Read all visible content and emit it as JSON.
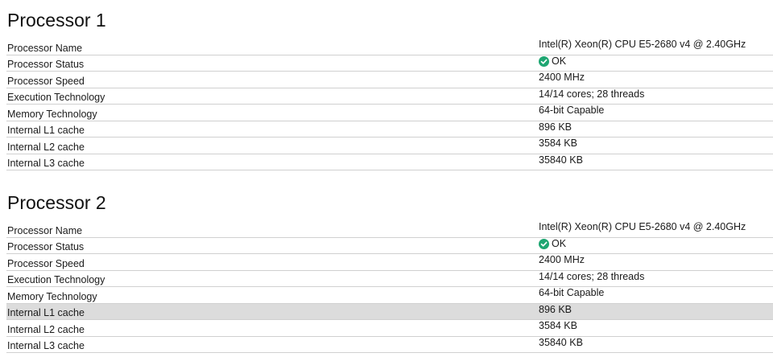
{
  "processors": [
    {
      "title": "Processor 1",
      "rows": [
        {
          "label": "Processor Name",
          "value": "Intel(R) Xeon(R) CPU E5-2680 v4 @ 2.40GHz"
        },
        {
          "label": "Processor Status",
          "value": "OK",
          "status_icon": "check-circle-icon",
          "status_color": "#1ea672"
        },
        {
          "label": "Processor Speed",
          "value": "2400 MHz"
        },
        {
          "label": "Execution Technology",
          "value": "14/14 cores; 28 threads"
        },
        {
          "label": "Memory Technology",
          "value": "64-bit Capable"
        },
        {
          "label": "Internal L1 cache",
          "value": "896 KB"
        },
        {
          "label": "Internal L2 cache",
          "value": "3584 KB"
        },
        {
          "label": "Internal L3 cache",
          "value": "35840 KB"
        }
      ]
    },
    {
      "title": "Processor 2",
      "rows": [
        {
          "label": "Processor Name",
          "value": "Intel(R) Xeon(R) CPU E5-2680 v4 @ 2.40GHz"
        },
        {
          "label": "Processor Status",
          "value": "OK",
          "status_icon": "check-circle-icon",
          "status_color": "#1ea672"
        },
        {
          "label": "Processor Speed",
          "value": "2400 MHz"
        },
        {
          "label": "Execution Technology",
          "value": "14/14 cores; 28 threads"
        },
        {
          "label": "Memory Technology",
          "value": "64-bit Capable"
        },
        {
          "label": "Internal L1 cache",
          "value": "896 KB",
          "highlighted": true
        },
        {
          "label": "Internal L2 cache",
          "value": "3584 KB"
        },
        {
          "label": "Internal L3 cache",
          "value": "35840 KB"
        }
      ]
    }
  ]
}
